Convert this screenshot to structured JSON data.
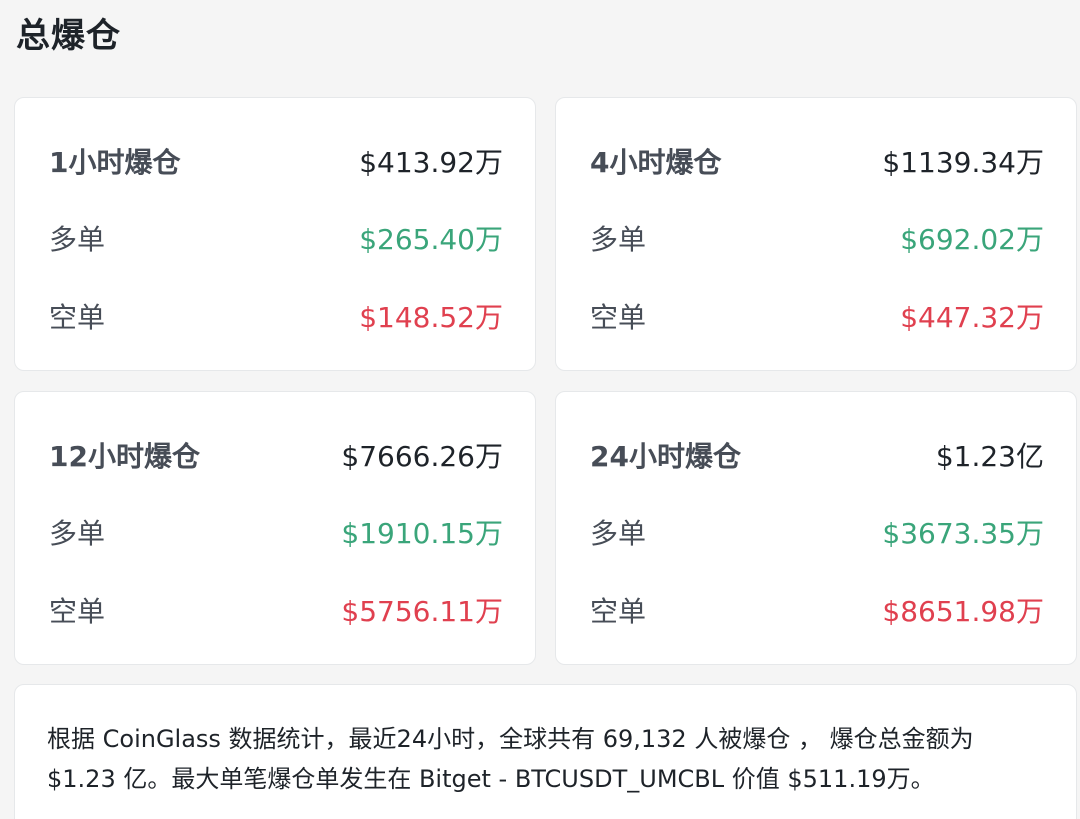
{
  "page": {
    "title": "总爆仓"
  },
  "cards": [
    {
      "title": "1小时爆仓",
      "total": "$413.92万",
      "long_label": "多单",
      "long_value": "$265.40万",
      "short_label": "空单",
      "short_value": "$148.52万"
    },
    {
      "title": "4小时爆仓",
      "total": "$1139.34万",
      "long_label": "多单",
      "long_value": "$692.02万",
      "short_label": "空单",
      "short_value": "$447.32万"
    },
    {
      "title": "12小时爆仓",
      "total": "$7666.26万",
      "long_label": "多单",
      "long_value": "$1910.15万",
      "short_label": "空单",
      "short_value": "$5756.11万"
    },
    {
      "title": "24小时爆仓",
      "total": "$1.23亿",
      "long_label": "多单",
      "long_value": "$3673.35万",
      "short_label": "空单",
      "short_value": "$8651.98万"
    }
  ],
  "summary": {
    "text": "根据 CoinGlass 数据统计，最近24小时，全球共有 69,132 人被爆仓 ， 爆仓总金额为 $1.23 亿。最大单笔爆仓单发生在 Bitget - BTCUSDT_UMCBL 价值 $511.19万。"
  },
  "colors": {
    "long": "#3aa57a",
    "short": "#e0404f",
    "text": "#1e2329",
    "label": "#474d57",
    "card_border": "#e6e8ea",
    "background": "#f5f5f5"
  }
}
